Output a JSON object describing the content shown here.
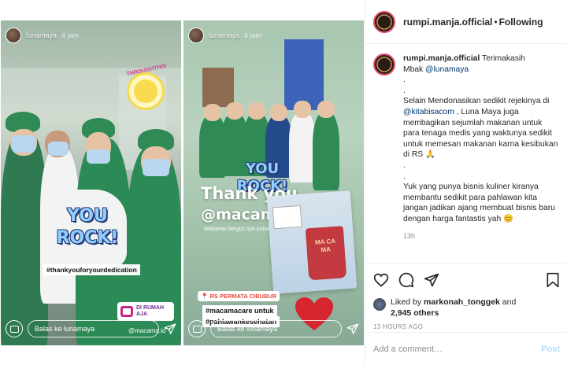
{
  "stories": [
    {
      "user": "lunamaya",
      "time": "4 jam",
      "sticker_top": "THROUGHTHIS",
      "sticker_you": "YOU",
      "sticker_rock": "ROCK!",
      "hashtag": "#thankyouforyourdedication",
      "rumah_1": "DI RUMAH",
      "rumah_2": "AJA",
      "mention": "@macama.id",
      "reply_placeholder": "Balas ke lunamaya"
    },
    {
      "user": "lunamaya",
      "time": "4 jam",
      "sticker_you": "YOU",
      "sticker_rock": "ROCK!",
      "thank_you": "Thank you",
      "macama": "@macama.id",
      "caption_small": "Makanan bergizi nya untuk kita",
      "location": "RS PERMATA CIBUBUR",
      "hashtag_1": "#macamacare untuk",
      "hashtag_2": "#pahlawankesehatan",
      "cup_text": "MA CA MA",
      "reply_placeholder": "Balas ke lunamaya"
    }
  ],
  "header": {
    "username": "rumpi.manja.official",
    "separator": "•",
    "follow_state": "Following"
  },
  "caption": {
    "username": "rumpi.manja.official",
    "line1": "Terimakasih",
    "line2_prefix": "Mbak ",
    "mention_1": "@lunamaya",
    "dot1": ".",
    "dot2": ".",
    "para1_a": "Selain Mendonasikan sedikit rejekinya di ",
    "mention_2": "@kitabisacom",
    "para1_b": " , Luna Maya juga membagikan sejumlah makanan untuk para tenaga medis yang waktunya sedikit untuk memesan makanan karna kesibukan di RS 🙏",
    "dot3": ".",
    "dot4": ".",
    "para2": "Yuk yang punya bisnis kuliner kiranya membantu sedikit para pahlawan kita jangan jadikan ajang membuat bisnis baru dengan harga fantastis yah 😊",
    "time": "13h"
  },
  "likes": {
    "prefix": "Liked by ",
    "user": "markonah_tonggek",
    "middle": " and",
    "count": "2,945 others"
  },
  "posted_ago": "13 HOURS AGO",
  "comment": {
    "placeholder": "Add a comment…",
    "post_label": "Post"
  },
  "colors": {
    "accent_link": "#00376b",
    "post_disabled": "#b2dffc",
    "story_ring": "#e24b6c"
  }
}
